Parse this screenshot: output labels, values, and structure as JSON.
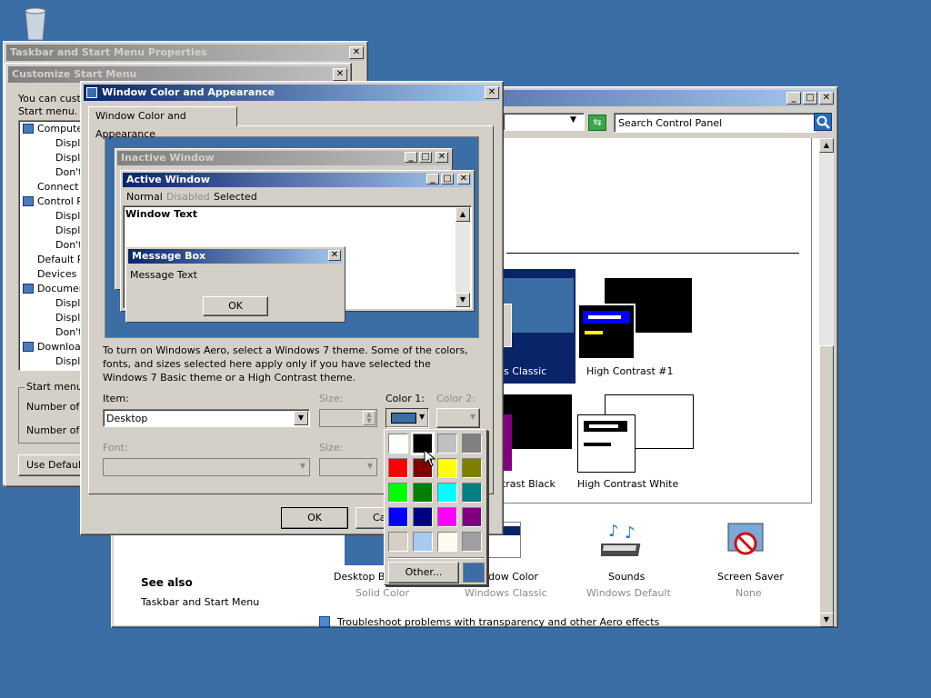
{
  "desktop": {
    "recycle_bin": "recycle-bin-icon"
  },
  "taskbar_props": {
    "title": "Taskbar and Start Menu Properties",
    "close": "✕"
  },
  "customize": {
    "title": "Customize Start Menu",
    "intro": [
      "You can custom",
      "Start menu."
    ],
    "tree": [
      {
        "label": "Compute",
        "indent": 0,
        "icon": "computer-icon"
      },
      {
        "label": "Displ",
        "indent": 1
      },
      {
        "label": "Displ",
        "indent": 1
      },
      {
        "label": "Don't",
        "indent": 1
      },
      {
        "label": "Connect",
        "indent": 0
      },
      {
        "label": "Control P",
        "indent": 0,
        "icon": "control-panel-icon"
      },
      {
        "label": "Displ",
        "indent": 1
      },
      {
        "label": "Displ",
        "indent": 1
      },
      {
        "label": "Don't",
        "indent": 1
      },
      {
        "label": "Default P",
        "indent": 0
      },
      {
        "label": "Devices a",
        "indent": 0
      },
      {
        "label": "Documen",
        "indent": 0,
        "icon": "documents-icon"
      },
      {
        "label": "Displ",
        "indent": 1
      },
      {
        "label": "Displ",
        "indent": 1
      },
      {
        "label": "Don't",
        "indent": 1
      },
      {
        "label": "Downloa",
        "indent": 0,
        "icon": "downloads-icon"
      },
      {
        "label": "Displ",
        "indent": 1
      }
    ],
    "size_group": "Start menu s",
    "number_of_1": "Number of re",
    "number_of_2": "Number of re",
    "use_default": "Use Default"
  },
  "control_panel": {
    "search_placeholder": "Search Control Panel",
    "themes": [
      {
        "label": "ws Classic"
      },
      {
        "label": "High Contrast #1"
      },
      {
        "label": "ntrast Black"
      },
      {
        "label": "High Contrast White"
      }
    ],
    "bottom_items": [
      {
        "label": "Desktop Bac",
        "sub": "Solid Color"
      },
      {
        "label": "dow Color",
        "sub": "Windows Classic"
      },
      {
        "label": "Sounds",
        "sub": "Windows Default"
      },
      {
        "label": "Screen Saver",
        "sub": "None"
      }
    ],
    "see_also": "See also",
    "see_also_link": "Taskbar and Start Menu",
    "troubleshoot": "Troubleshoot problems with transparency and other Aero effects"
  },
  "wca": {
    "title": "Window Color and Appearance",
    "tab": "Window Color and Appearance",
    "preview": {
      "inactive": "Inactive Window",
      "active": "Active Window",
      "menu_normal": "Normal",
      "menu_disabled": "Disabled",
      "menu_selected": "Selected",
      "window_text": "Window Text",
      "msgbox_title": "Message Box",
      "msgbox_text": "Message Text",
      "ok": "OK"
    },
    "info": "To turn on Windows Aero, select a Windows 7 theme.  Some of the colors, fonts, and sizes selected here apply only if you have selected the Windows 7 Basic theme or a High Contrast theme.",
    "item_label": "Item:",
    "item_value": "Desktop",
    "size_label": "Size:",
    "color1_label": "Color 1:",
    "color2_label": "Color 2:",
    "font_label": "Font:",
    "size2_label": "Size:",
    "ok": "OK",
    "cancel": "Ca",
    "selected_color": "#3a6ea5"
  },
  "palette": {
    "colors": [
      "#ffffff",
      "#000000",
      "#c0c0c0",
      "#808080",
      "#ff0000",
      "#800000",
      "#ffff00",
      "#808000",
      "#00ff00",
      "#008000",
      "#00ffff",
      "#008080",
      "#0000ff",
      "#000080",
      "#ff00ff",
      "#800080",
      "#d4d0c8",
      "#a6caf0",
      "#fffbf0",
      "#a0a0a4"
    ],
    "other": "Other..."
  }
}
